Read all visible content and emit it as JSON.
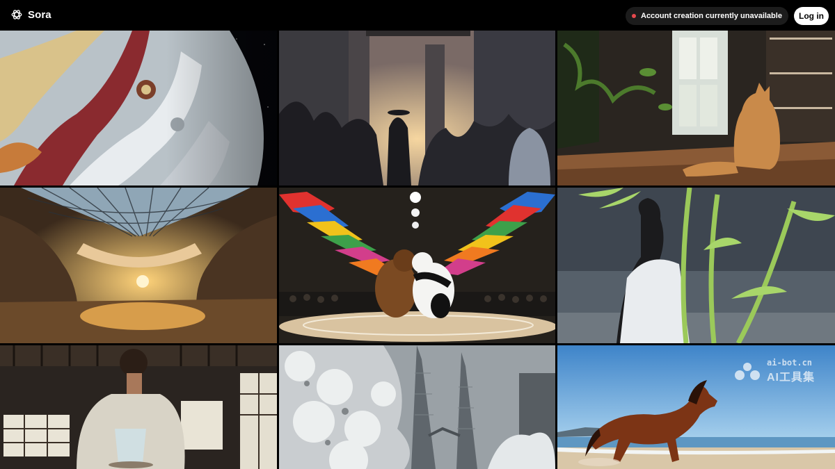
{
  "header": {
    "brand_name": "Sora",
    "logo_icon": "openai-logo-icon",
    "notice_text": "Account creation currently unavailable",
    "notice_dot_color": "#e5484d",
    "login_label": "Log in"
  },
  "gallery": {
    "tiles": [
      {
        "subject": "gas-giant-planet"
      },
      {
        "subject": "crowd-in-grand-hall"
      },
      {
        "subject": "orange-cat-by-window"
      },
      {
        "subject": "domed-atrium-sunset"
      },
      {
        "subject": "bear-and-panda-sumo"
      },
      {
        "subject": "person-behind-bamboo"
      },
      {
        "subject": "man-preparing-tea"
      },
      {
        "subject": "snowy-twin-towers"
      },
      {
        "subject": "horse-on-beach"
      }
    ]
  },
  "watermark": {
    "line1": "ai-bot.cn",
    "line2": "AI工具集"
  }
}
